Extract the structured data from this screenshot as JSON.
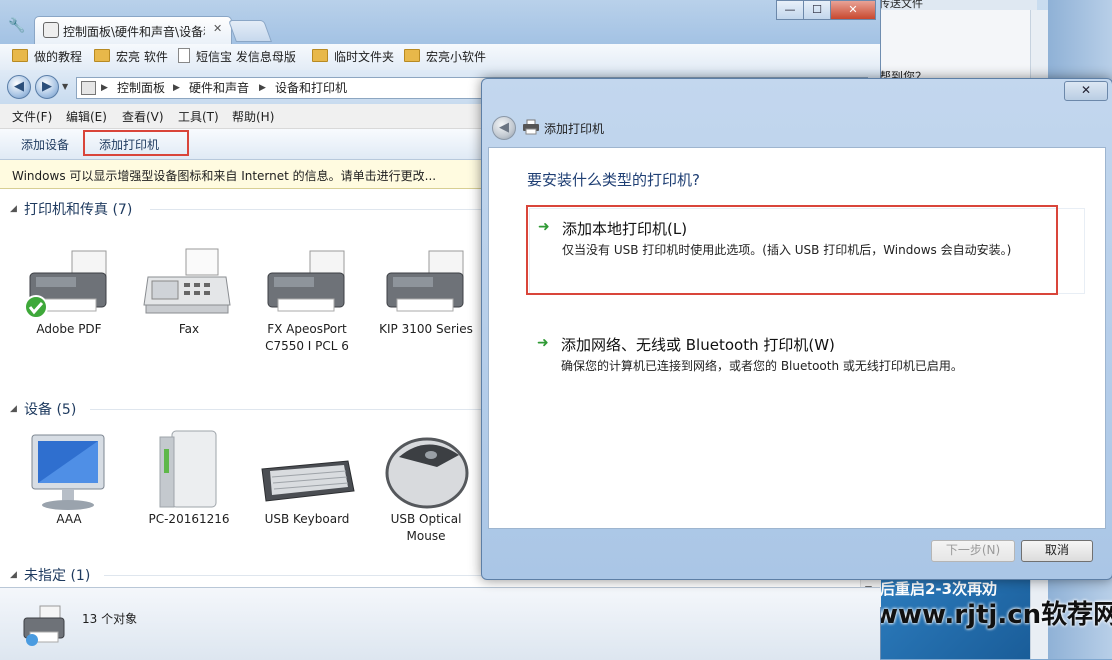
{
  "browser_tab": {
    "title": "控制面板\\硬件和声音\\设备和打印机"
  },
  "favorites": [
    {
      "label": "做的教程",
      "icon": "folder-icon"
    },
    {
      "label": "宏亮 软件",
      "icon": "folder-icon"
    },
    {
      "label": "短信宝 发信息母版",
      "icon": "document-icon"
    },
    {
      "label": "临时文件夹",
      "icon": "folder-icon"
    },
    {
      "label": "宏亮小软件",
      "icon": "folder-icon"
    }
  ],
  "address": {
    "crumbs": [
      "控制面板",
      "硬件和声音",
      "设备和打印机"
    ]
  },
  "menu": [
    "文件(F)",
    "编辑(E)",
    "查看(V)",
    "工具(T)",
    "帮助(H)"
  ],
  "commands": {
    "add_device": "添加设备",
    "add_printer": "添加打印机"
  },
  "infobar": "Windows 可以显示增强型设备图标和来自 Internet 的信息。请单击进行更改...",
  "groups": {
    "printers": {
      "title": "打印机和传真 (7)",
      "items": [
        {
          "name": "Adobe PDF",
          "icon": "printer-default-icon"
        },
        {
          "name": "Fax",
          "icon": "fax-icon"
        },
        {
          "name": "FX ApeosPort\nC7550 I PCL 6",
          "icon": "printer-icon"
        },
        {
          "name": "KIP 3100 Series",
          "icon": "printer-icon"
        }
      ]
    },
    "devices": {
      "title": "设备 (5)",
      "items": [
        {
          "name": "AAA",
          "icon": "monitor-icon"
        },
        {
          "name": "PC-20161216",
          "icon": "computer-tower-icon"
        },
        {
          "name": "USB Keyboard",
          "icon": "keyboard-icon"
        },
        {
          "name": "USB Optical\nMouse",
          "icon": "mouse-icon"
        }
      ]
    },
    "unspecified": {
      "title": "未指定 (1)"
    }
  },
  "status": {
    "count": "13 个对象"
  },
  "dialog": {
    "title": "添加打印机",
    "close": "✕",
    "question": "要安装什么类型的打印机?",
    "options": [
      {
        "title": "添加本地打印机(L)",
        "desc": "仅当没有 USB 打印机时使用此选项。(插入 USB 打印机后，Windows 会自动安装。)"
      },
      {
        "title": "添加网络、无线或 Bluetooth 打印机(W)",
        "desc": "确保您的计算机已连接到网络，或者您的 Bluetooth 或无线打印机已启用。"
      }
    ],
    "next": "下一步(N)",
    "cancel": "取消"
  },
  "background_browser": {
    "tab_fragment": "传送文件",
    "help_text": "帮到您？",
    "promo_text": "后重启2-3次再劝",
    "watermark": "www.rjtj.cn软荐网"
  },
  "colors": {
    "highlight_box": "#d9453a",
    "accent": "#1f3f74",
    "go_arrow": "#2f9a34"
  }
}
